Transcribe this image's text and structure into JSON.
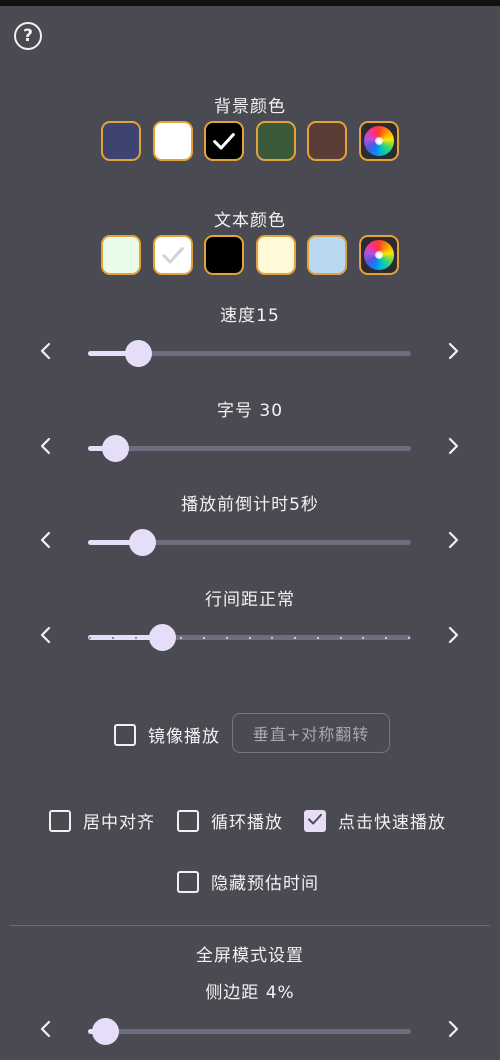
{
  "help_icon": "question-circle-icon",
  "background_color": {
    "label": "背景颜色",
    "swatches": [
      "#3e4470",
      "#ffffff",
      "#000000",
      "#3c5a3a",
      "#5a3e35",
      "color-wheel"
    ],
    "selected_index": 2
  },
  "text_color": {
    "label": "文本颜色",
    "swatches": [
      "#e9fbe9",
      "#ffffff",
      "#000000",
      "#fff9d9",
      "#b9d8f2",
      "color-wheel"
    ],
    "selected_index": 1
  },
  "sliders": {
    "speed": {
      "label": "速度15",
      "value_fraction": 0.155
    },
    "font_size": {
      "label": "字号 30",
      "value_fraction": 0.085
    },
    "countdown": {
      "label": "播放前倒计时5秒",
      "value_fraction": 0.17
    },
    "line_spacing": {
      "label": "行间距正常",
      "value_fraction": 0.23,
      "steps": 14
    },
    "side_margin": {
      "label": "侧边距 4%",
      "value_fraction": 0.055
    }
  },
  "options": {
    "mirror": {
      "label": "镜像播放",
      "checked": false
    },
    "flip_button": "垂直+对称翻转",
    "center_align": {
      "label": "居中对齐",
      "checked": false
    },
    "loop": {
      "label": "循环播放",
      "checked": false
    },
    "tap_fast": {
      "label": "点击快速播放",
      "checked": true
    },
    "hide_estimate": {
      "label": "隐藏预估时间",
      "checked": false
    }
  },
  "fullscreen": {
    "title": "全屏模式设置"
  },
  "colors": {
    "accent": "#e6def8",
    "background": "#4a4a52",
    "swatch_border": "#e4a33a"
  }
}
